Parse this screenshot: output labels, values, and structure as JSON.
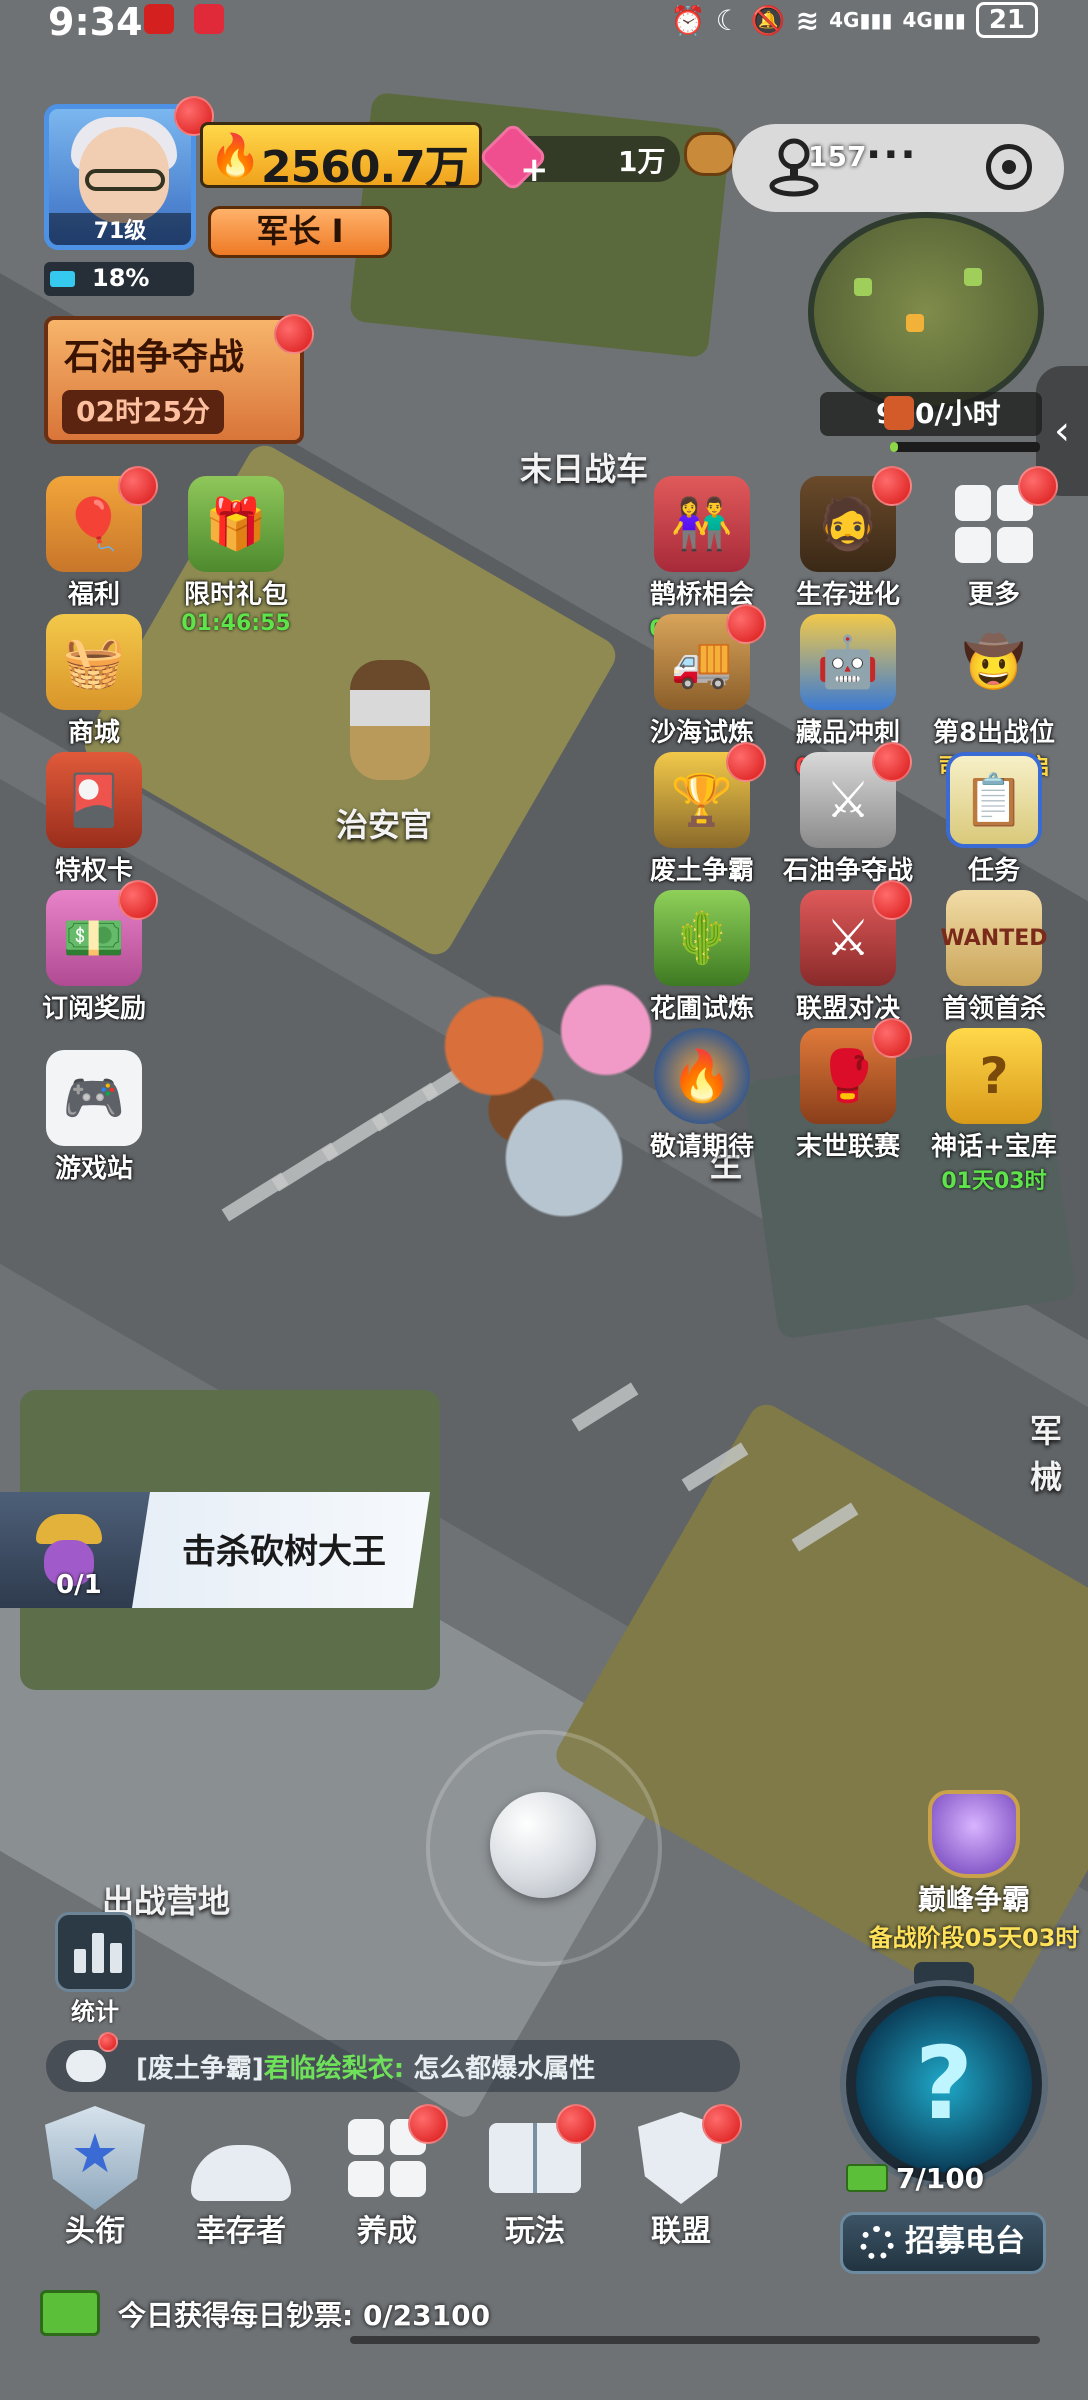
{
  "status_bar": {
    "time": "9:34",
    "battery": "21",
    "network_1": "4G",
    "network_2": "4G"
  },
  "player": {
    "level": "71级",
    "power": "2560.7万",
    "rank": "军长 I",
    "exp_percent": "18%",
    "exp_fraction": 0.18
  },
  "resources": {
    "gems": "1万",
    "wood": "157"
  },
  "event_banner": {
    "title": "石油争夺战",
    "timer": "02时25分"
  },
  "map": {
    "oil_rate": "960/小时",
    "oil_fill": 0.05
  },
  "scene_labels": {
    "truck": "末日战车",
    "sheriff": "治安官",
    "camp": "出战营地",
    "partial_right": "军械",
    "partial_center": "生"
  },
  "features_left": [
    {
      "name": "welfare",
      "label": "福利",
      "sub": ""
    },
    {
      "name": "shop",
      "label": "商城",
      "sub": ""
    },
    {
      "name": "privilege-card",
      "label": "特权卡",
      "sub": ""
    },
    {
      "name": "subscription-reward",
      "label": "订阅奖励",
      "sub": ""
    },
    {
      "name": "game-station",
      "label": "游戏站",
      "sub": ""
    }
  ],
  "features_gift": {
    "label": "限时礼包",
    "sub": "01:46:55"
  },
  "features_right": [
    {
      "name": "magpie-bridge",
      "label": "鹊桥相会",
      "sub": "05天03时"
    },
    {
      "name": "survival-evolution",
      "label": "生存进化",
      "sub": ""
    },
    {
      "name": "more",
      "label": "更多",
      "sub": ""
    },
    {
      "name": "desert-trial",
      "label": "沙海试炼",
      "sub": ""
    },
    {
      "name": "collection-sprint",
      "label": "藏品冲刺",
      "sub": "02时25分"
    },
    {
      "name": "battle-slot-8",
      "label": "第8出战位",
      "sub": "司令 I 开启"
    },
    {
      "name": "wasteland-contest",
      "label": "废土争霸",
      "sub": ""
    },
    {
      "name": "oil-contest",
      "label": "石油争夺战",
      "sub": ""
    },
    {
      "name": "tasks",
      "label": "任务",
      "sub": ""
    },
    {
      "name": "garden-trial",
      "label": "花圃试炼",
      "sub": ""
    },
    {
      "name": "alliance-duel",
      "label": "联盟对决",
      "sub": ""
    },
    {
      "name": "boss-first-kill",
      "label": "首领首杀",
      "sub": ""
    },
    {
      "name": "coming-soon",
      "label": "敬请期待",
      "sub": ""
    },
    {
      "name": "doomsday-league",
      "label": "末世联赛",
      "sub": ""
    },
    {
      "name": "myth-vault",
      "label": "神话+宝库",
      "sub": "01天03时"
    }
  ],
  "quest": {
    "count": "0/1",
    "text": "击杀砍树大王"
  },
  "stats": {
    "label": "统计"
  },
  "chat": {
    "channel": "[废土争霸]",
    "sender": "君临绘梨衣:",
    "message": " 怎么都爆水属性"
  },
  "peak": {
    "title": "巅峰争霸",
    "sub": "备战阶段05天03时"
  },
  "recruit": {
    "count": "7/100",
    "button": "招募电台",
    "question": "?"
  },
  "nav": [
    {
      "name": "title",
      "label": "头衔"
    },
    {
      "name": "survivors",
      "label": "幸存者"
    },
    {
      "name": "develop",
      "label": "养成"
    },
    {
      "name": "gameplay",
      "label": "玩法"
    },
    {
      "name": "alliance",
      "label": "联盟"
    }
  ],
  "tip": {
    "text": "今日获得每日钞票: 0/23100"
  },
  "colors": {
    "red_dot": "#d81616",
    "timer_green": "#5ee34a",
    "timer_red": "#ff4040",
    "gold": "#ffd84a"
  }
}
